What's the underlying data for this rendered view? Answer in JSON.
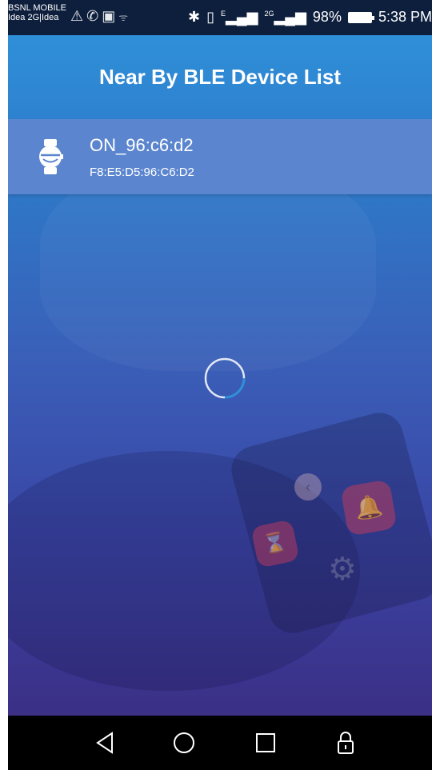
{
  "status_bar": {
    "carrier_1": "BSNL MOBILE",
    "carrier_2": "Idea 2G|Idea",
    "left_icons": [
      "warning-icon",
      "whatsapp-icon",
      "image-icon",
      "wifi-icon"
    ],
    "right_icons": [
      "bluetooth-icon",
      "vibrate-icon",
      "signal-icon",
      "signal-2g-icon"
    ],
    "network_1": "E",
    "network_2": "2G",
    "battery": "98%",
    "time": "5:38 PM"
  },
  "header": {
    "title": "Near By BLE Device List"
  },
  "devices": [
    {
      "name": "ON_96:c6:d2",
      "mac": "F8:E5:D5:96:C6:D2",
      "icon": "smartwatch-icon"
    }
  ],
  "loading": {
    "icon": "loading-spinner"
  },
  "nav_bar": {
    "buttons": [
      "back-icon",
      "home-icon",
      "recents-icon",
      "lock-icon"
    ]
  },
  "colors": {
    "status_bar": "#0e1f3d",
    "gradient_top": "#2f8fd8",
    "gradient_bottom": "#3b2f86",
    "device_row": "#5b86cf",
    "spinner_accent": "#2f8fd8",
    "nav_bar": "#000000"
  }
}
